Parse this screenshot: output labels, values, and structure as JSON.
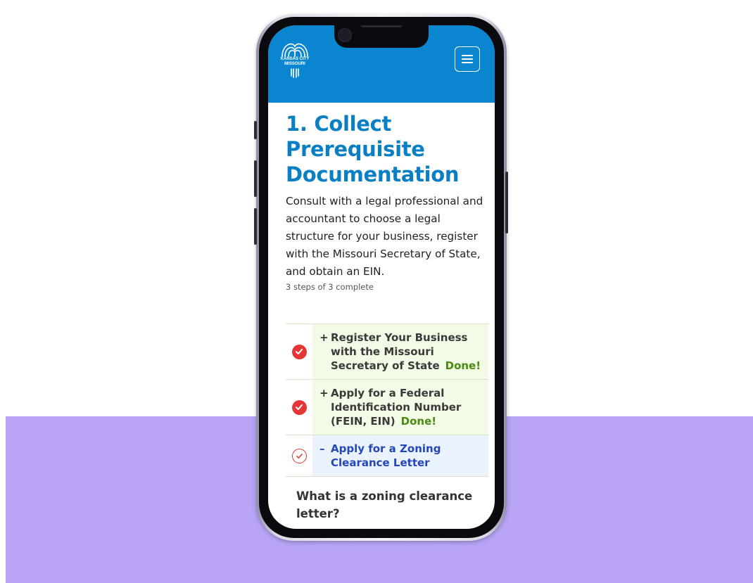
{
  "header": {
    "logo_line1": "KANSAS CITY",
    "logo_line2": "MISSOURI",
    "menu_icon": "hamburger-icon"
  },
  "main": {
    "title": "1. Collect Prerequisite Documentation",
    "intro": "Consult with a legal professional and accountant to choose a legal structure for your business, register with the Missouri Secretary of State, and obtain an EIN.",
    "progress": "3 steps of 3 complete"
  },
  "steps": [
    {
      "toggle": "+",
      "title": "Register Your Business with the Missouri Secretary of State",
      "status": "Done!"
    },
    {
      "toggle": "+",
      "title": "Apply for a Federal Identification Number (FEIN, EIN)",
      "status": "Done!"
    },
    {
      "toggle": "–",
      "title": "Apply for a Zoning Clearance Letter",
      "status": ""
    }
  ],
  "section": {
    "heading": "What is a zoning clearance letter?"
  },
  "colors": {
    "header_bg": "#0a85cf",
    "title": "#0a7fc4",
    "done_green": "#4b8a12",
    "check_red": "#e43636",
    "open_link": "#2447b8",
    "backdrop": "#b8a3f5"
  }
}
